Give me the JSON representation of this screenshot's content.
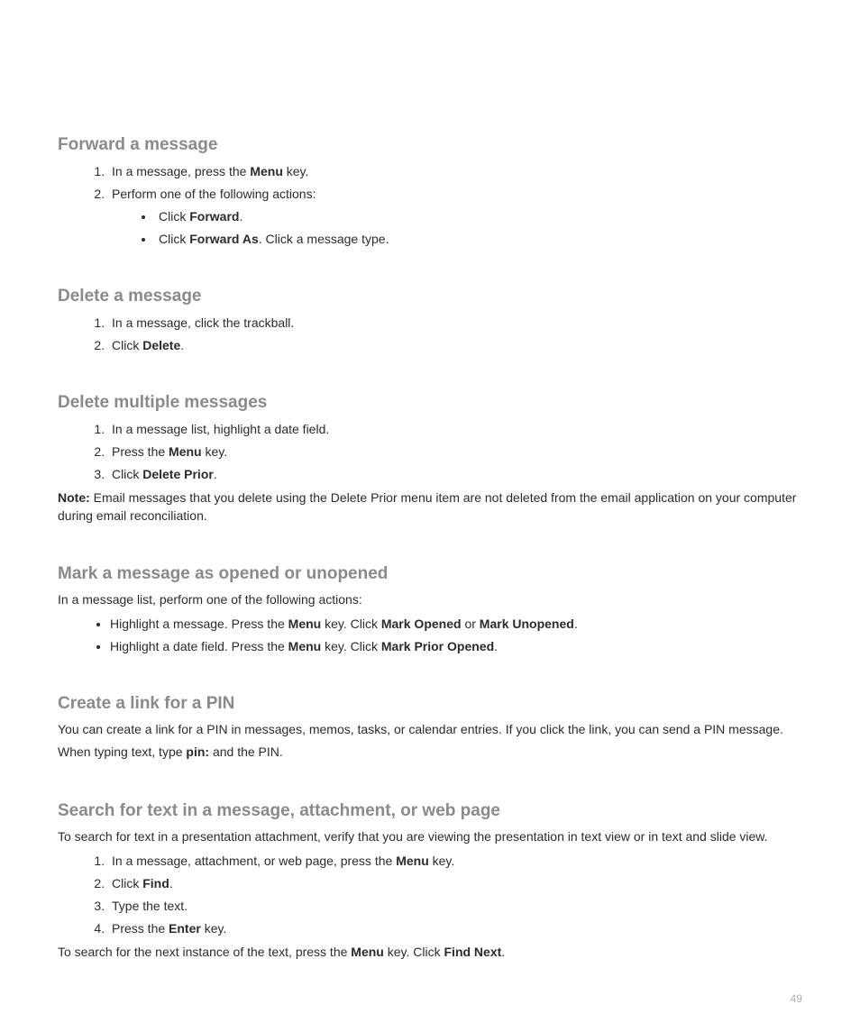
{
  "page_number": "49",
  "sections": {
    "forward": {
      "heading": "Forward a message",
      "step1_pre": "In a message, press the ",
      "step1_bold": "Menu",
      "step1_post": " key.",
      "step2": "Perform one of the following actions:",
      "bullet1_pre": "Click ",
      "bullet1_bold": "Forward",
      "bullet1_post": ".",
      "bullet2_pre": "Click ",
      "bullet2_bold": "Forward As",
      "bullet2_post": ". Click a message type."
    },
    "delete": {
      "heading": "Delete a message",
      "step1": "In a message, click the trackball.",
      "step2_pre": "Click ",
      "step2_bold": "Delete",
      "step2_post": "."
    },
    "delete_multi": {
      "heading": "Delete multiple messages",
      "step1": "In a message list, highlight a date field.",
      "step2_pre": "Press the ",
      "step2_bold": "Menu",
      "step2_post": " key.",
      "step3_pre": "Click ",
      "step3_bold": "Delete Prior",
      "step3_post": ".",
      "note_label": "Note:",
      "note_text": "  Email messages that you delete using the Delete Prior menu item are not deleted from the email application on your computer during email reconciliation."
    },
    "mark": {
      "heading": "Mark a message as opened or unopened",
      "intro": "In a message list, perform one of the following actions:",
      "b1_t1": "Highlight a message. Press the ",
      "b1_b1": "Menu",
      "b1_t2": " key. Click ",
      "b1_b2": "Mark Opened",
      "b1_t3": " or ",
      "b1_b3": "Mark Unopened",
      "b1_t4": ".",
      "b2_t1": "Highlight a date field. Press the ",
      "b2_b1": "Menu",
      "b2_t2": " key. Click ",
      "b2_b2": "Mark Prior Opened",
      "b2_t3": "."
    },
    "pin": {
      "heading": "Create a link for a PIN",
      "p1": "You can create a link for a PIN in messages, memos, tasks, or calendar entries. If you click the link, you can send a PIN message.",
      "p2_pre": "When typing text, type ",
      "p2_bold": "pin:",
      "p2_post": " and the PIN."
    },
    "search": {
      "heading": "Search for text in a message, attachment, or web page",
      "intro": "To search for text in a presentation attachment, verify that you are viewing the presentation in text view or in text and slide view.",
      "s1_pre": "In a message, attachment, or web page, press the ",
      "s1_bold": "Menu",
      "s1_post": " key.",
      "s2_pre": "Click ",
      "s2_bold": "Find",
      "s2_post": ".",
      "s3": "Type the text.",
      "s4_pre": "Press the ",
      "s4_bold": "Enter",
      "s4_post": " key.",
      "outro_t1": "To search for the next instance of the text, press the ",
      "outro_b1": "Menu",
      "outro_t2": " key. Click ",
      "outro_b2": "Find Next",
      "outro_t3": "."
    }
  }
}
